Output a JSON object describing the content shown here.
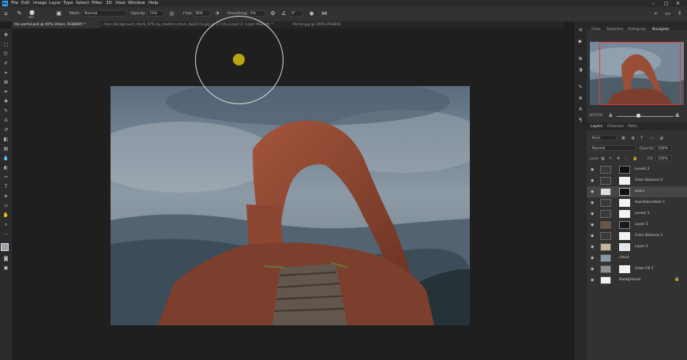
{
  "menu": {
    "logo": "Ps",
    "items": [
      "File",
      "Edit",
      "Image",
      "Layer",
      "Type",
      "Select",
      "Filter",
      "3D",
      "View",
      "Window",
      "Help"
    ]
  },
  "options": {
    "mode_label": "Mode:",
    "mode_value": "Normal",
    "opacity_label": "Opacity:",
    "opacity_value": "72%",
    "flow_label": "Flow:",
    "flow_value": "39%",
    "smoothing_label": "Smoothing:",
    "smoothing_value": "0%",
    "angle_value": "0°",
    "brush_size": "560"
  },
  "tabs": [
    {
      "label": "the portal.psd @ 40% (stairs, RGB/8#) *"
    },
    {
      "label": "misc_background_stock_078_by_malleni_stock_dwi157a.jpg @ 17,1% (Layer 0, Layer Mask/8) *"
    },
    {
      "label": "Portal.jpg @ 100% (RGB/8)"
    }
  ],
  "right_top_panels": {
    "tabs": [
      "Color",
      "Swatches",
      "Histogram",
      "Navigator"
    ],
    "zoom": "40,03%"
  },
  "layers_panel": {
    "tabs": [
      "Layers",
      "Channels",
      "Paths"
    ],
    "kind": "Kind",
    "blend_mode": "Normal",
    "opacity_label": "Opacity:",
    "opacity_value": "100%",
    "lock_label": "Lock:",
    "fill_label": "Fill:",
    "fill_value": "100%",
    "layers": [
      {
        "name": "Levels 2"
      },
      {
        "name": "Color Balance 2"
      },
      {
        "name": "stairs"
      },
      {
        "name": "Hue/Saturation 1"
      },
      {
        "name": "Levels 1"
      },
      {
        "name": "Layer 1"
      },
      {
        "name": "Color Balance 1"
      },
      {
        "name": "Layer 2"
      },
      {
        "name": "cloud"
      },
      {
        "name": "Color Fill 1"
      },
      {
        "name": "Background"
      }
    ]
  },
  "colors": {
    "accent": "#31a8ff",
    "nav_frame": "#e23b3b",
    "brush_dot": "#b8a511"
  }
}
